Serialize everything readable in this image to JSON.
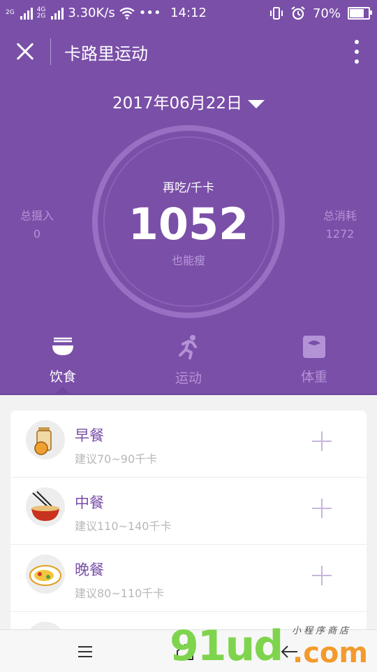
{
  "status_bar": {
    "net_1": "2G",
    "net_2": "4G",
    "net_3": "2G",
    "speed": "3.30K/s",
    "more": "•••",
    "time": "14:12",
    "battery": "70%",
    "battery_level": 0.7
  },
  "appbar": {
    "title": "卡路里运动"
  },
  "date": "2017年06月22日",
  "summary": {
    "top_label": "再吃/千卡",
    "value": "1052",
    "bottom_label": "也能瘦",
    "intake_label": "总摄入",
    "intake_value": "0",
    "burn_label": "总消耗",
    "burn_value": "1272"
  },
  "tabs": [
    {
      "label": "饮食",
      "icon": "food-bowl-icon"
    },
    {
      "label": "运动",
      "icon": "running-icon"
    },
    {
      "label": "体重",
      "icon": "scale-icon"
    }
  ],
  "meals": [
    {
      "name": "早餐",
      "hint": "建议70~90千卡",
      "icon": "breakfast-icon"
    },
    {
      "name": "中餐",
      "hint": "建议110~140千卡",
      "icon": "lunch-icon"
    },
    {
      "name": "晚餐",
      "hint": "建议80~110千卡",
      "icon": "dinner-icon"
    }
  ],
  "watermark": {
    "brand": "91ud",
    "domain": ".com",
    "tagline": "小程序商店"
  },
  "colors": {
    "header": "#7a4fa8",
    "accent_text": "#7a4fa8",
    "muted": "#b393d6"
  }
}
